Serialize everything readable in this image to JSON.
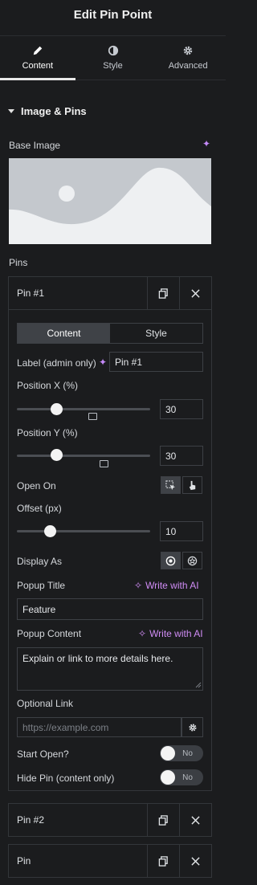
{
  "header": {
    "title": "Edit Pin Point"
  },
  "tabs": [
    {
      "label": "Content",
      "icon": "pencil-icon",
      "active": true
    },
    {
      "label": "Style",
      "icon": "half-circle-icon",
      "active": false
    },
    {
      "label": "Advanced",
      "icon": "gear-icon",
      "active": false
    }
  ],
  "section": {
    "title": "Image & Pins"
  },
  "base_image": {
    "label": "Base Image"
  },
  "pins": {
    "label": "Pins",
    "items": [
      {
        "title": "Pin #1"
      },
      {
        "title": "Pin #2"
      },
      {
        "title": "Pin"
      }
    ]
  },
  "pin_editor": {
    "seg_content": "Content",
    "seg_style": "Style",
    "label_field": {
      "label": "Label (admin only)",
      "value": "Pin #1"
    },
    "position_x": {
      "label": "Position X (%)",
      "value": "30"
    },
    "position_y": {
      "label": "Position Y (%)",
      "value": "30"
    },
    "open_on": {
      "label": "Open On"
    },
    "offset": {
      "label": "Offset (px)",
      "value": "10"
    },
    "display_as": {
      "label": "Display As"
    },
    "popup_title": {
      "label": "Popup Title",
      "ai": "Write with AI",
      "value": "Feature"
    },
    "popup_content": {
      "label": "Popup Content",
      "ai": "Write with AI",
      "value": "Explain or link to more details here."
    },
    "optional_link": {
      "label": "Optional Link",
      "placeholder": "https://example.com"
    },
    "start_open": {
      "label": "Start Open?",
      "toggle": "No"
    },
    "hide_pin": {
      "label": "Hide Pin (content only)",
      "toggle": "No"
    }
  }
}
